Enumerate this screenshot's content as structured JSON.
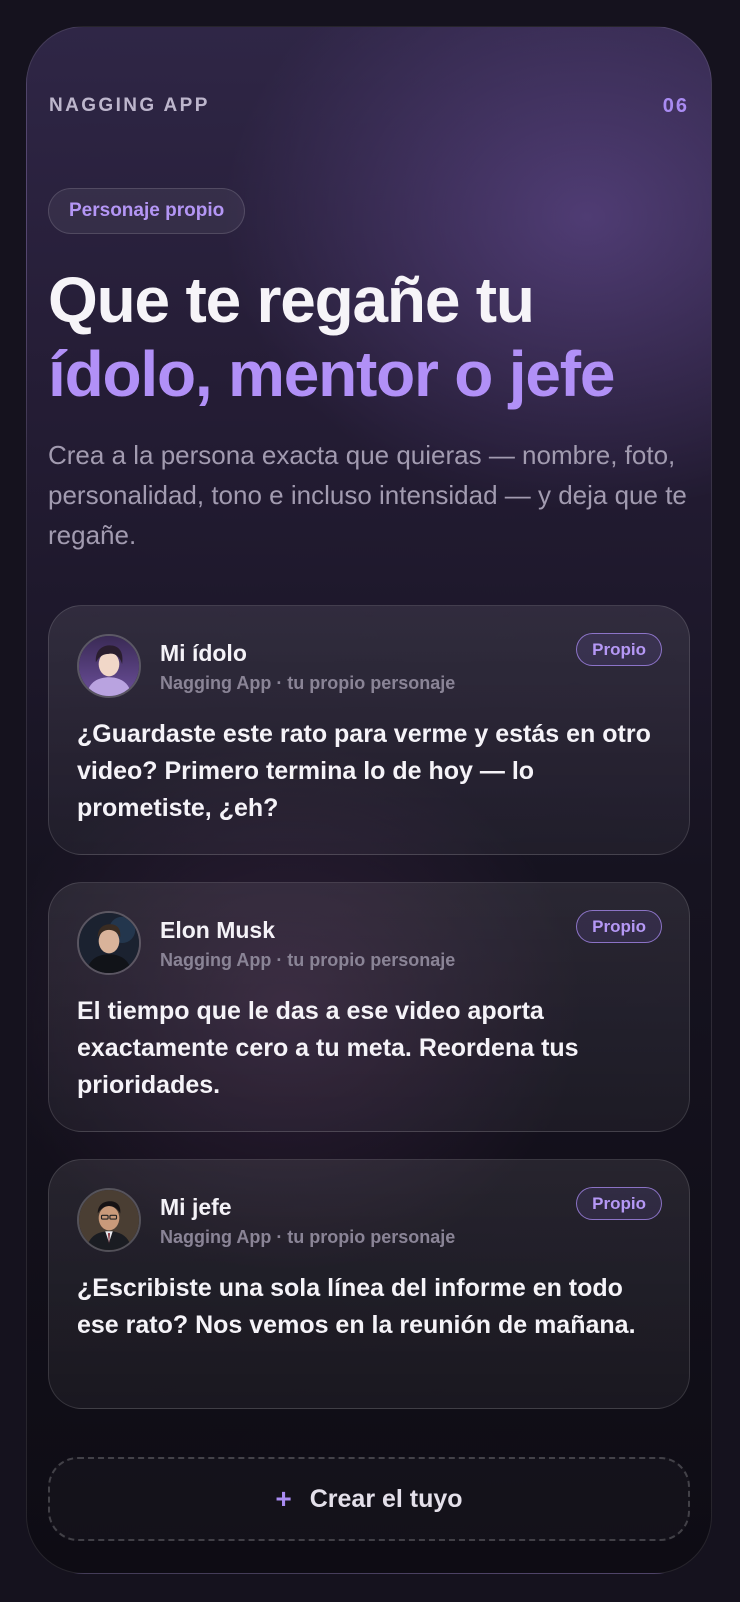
{
  "header": {
    "app_name": "NAGGING APP",
    "page_number": "06"
  },
  "tag_pill": "Personaje propio",
  "headline": {
    "line1": "Que te regañe tu",
    "line2": "ídolo, mentor o jefe"
  },
  "subtitle": "Crea a la persona exacta que quieras — nombre, foto, personalidad, tono e incluso intensidad — y deja que te regañe.",
  "cards": [
    {
      "name": "Mi ídolo",
      "meta": "Nagging App · tu propio personaje",
      "badge": "Propio",
      "message": "¿Guardaste este rato para verme y estás en otro video? Primero termina lo de hoy — lo prometiste, ¿eh?",
      "avatar_icon": "idol-avatar"
    },
    {
      "name": "Elon Musk",
      "meta": "Nagging App · tu propio personaje",
      "badge": "Propio",
      "message": "El tiempo que le das a ese video aporta exactamente cero a tu meta. Reordena tus prioridades.",
      "avatar_icon": "elon-avatar"
    },
    {
      "name": "Mi jefe",
      "meta": "Nagging App · tu propio personaje",
      "badge": "Propio",
      "message": "¿Escribiste una sola línea del informe en todo ese rato? Nos vemos en la reunión de mañana.",
      "avatar_icon": "boss-avatar"
    }
  ],
  "create_button": {
    "icon": "plus-icon",
    "label": "Crear el tuyo"
  },
  "colors": {
    "accent": "#a98bf2",
    "background": "#15121e",
    "text": "#f3f1f7",
    "muted": "#a29bb0"
  }
}
